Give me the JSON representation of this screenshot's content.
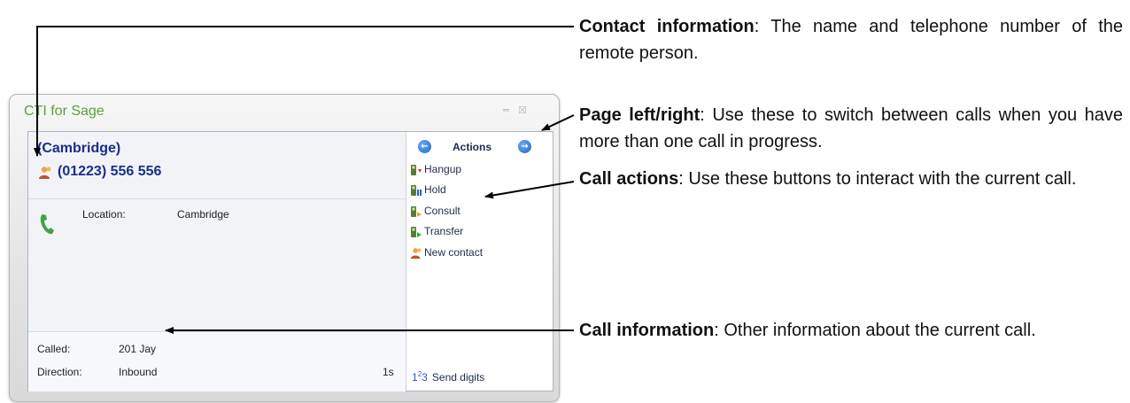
{
  "window": {
    "title": "CTI for Sage",
    "contact_name": "(Cambridge)",
    "contact_phone": "(01223) 556 556",
    "details": {
      "location_label": "Location:",
      "location_value": "Cambridge"
    },
    "call_info": {
      "called_label": "Called:",
      "called_value": "201 Jay",
      "direction_label": "Direction:",
      "direction_value": "Inbound",
      "duration": "1s"
    },
    "actions": {
      "title": "Actions",
      "items": [
        "Hangup",
        "Hold",
        "Consult",
        "Transfer",
        "New contact"
      ],
      "send_digits_num_1": "1",
      "send_digits_num_2": "2",
      "send_digits_num_3": "3",
      "send_digits_label": "Send digits"
    }
  },
  "annotations": {
    "contact": {
      "title": "Contact information",
      "text": ": The name and telephone number of the remote person."
    },
    "page": {
      "title": "Page left/right",
      "text": ": Use these to switch between calls when you have more than one call in progress."
    },
    "actions": {
      "title": "Call actions",
      "text": ": Use these buttons to interact with the current call."
    },
    "callinfo": {
      "title": "Call information",
      "text": ": Other information about the current call."
    }
  },
  "colors": {
    "title_green": "#5d9c3f",
    "contact_blue": "#1a2e8a",
    "nav_blue": "#1c62c8"
  }
}
